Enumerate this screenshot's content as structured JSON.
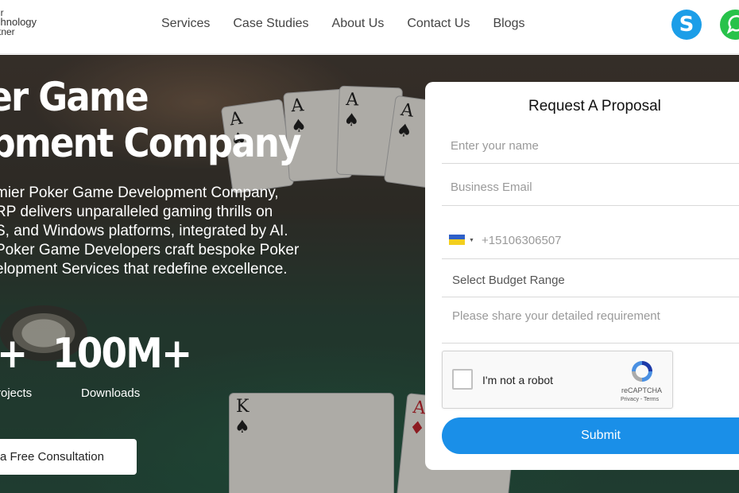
{
  "header": {
    "logo_lines": [
      "ur",
      "chnology",
      "rtner"
    ],
    "nav": [
      "Services",
      "Case Studies",
      "About Us",
      "Contact Us",
      "Blogs"
    ],
    "icons": [
      "skype-icon",
      "whatsapp-icon"
    ]
  },
  "hero": {
    "title_line1": "er Game",
    "title_line2": "elopment Company",
    "intro_lines": [
      "mier Poker Game Development Company,",
      "RP delivers unparalleled gaming thrills on",
      "S, and Windows platforms, integrated by AI.",
      "Poker Game Developers craft bespoke Poker",
      "elopment Services that redefine excellence."
    ],
    "stats": [
      {
        "value": "+",
        "label": "rojects"
      },
      {
        "value": "100M+",
        "label": "Downloads"
      }
    ],
    "cta_label": "a Free Consultation"
  },
  "form": {
    "title": "Request A Proposal",
    "name_placeholder": "Enter your name",
    "email_placeholder": "Business Email",
    "phone_placeholder": "+15106306507",
    "budget_label": "Select Budget Range",
    "requirement_placeholder": "Please share your detailed requirement",
    "captcha": {
      "label": "I'm not a robot",
      "brand": "reCAPTCHA",
      "links": "Privacy - Terms"
    },
    "submit_label": "Submit"
  },
  "colors": {
    "accent": "#1a8fe8",
    "skype": "#1c9ee8",
    "whatsapp": "#27c24a"
  }
}
